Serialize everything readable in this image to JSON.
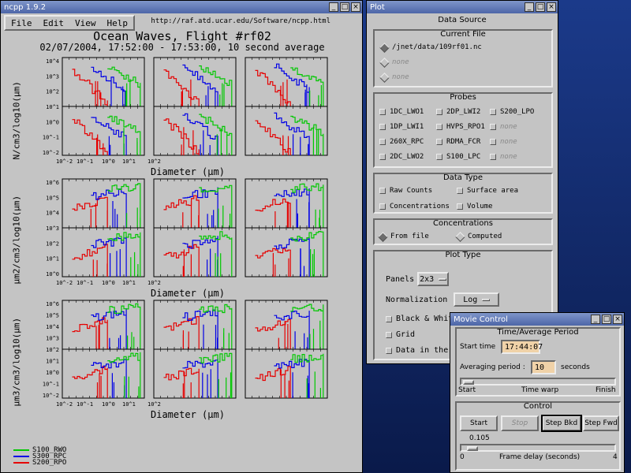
{
  "ncpp": {
    "title": "ncpp 1.9.2",
    "menu": [
      "File",
      "Edit",
      "View",
      "Help"
    ],
    "url": "http://raf.atd.ucar.edu/Software/ncpp.html",
    "plot_title": "Ocean Waves, Flight #rf02",
    "plot_subtitle": "02/07/2004, 17:52:00 - 17:53:00, 10 second average",
    "sections": [
      {
        "ylabel": "N/cm3/log10(μm)",
        "ticks_y": [
          "10^4",
          "10^3",
          "10^2",
          "10^1",
          "10^0",
          "10^-1",
          "10^-2"
        ],
        "xlabel": "Diameter (μm)"
      },
      {
        "ylabel": "μm2/cm3/log10(μm)",
        "ticks_y": [
          "10^6",
          "10^5",
          "10^4",
          "10^3",
          "10^2",
          "10^1",
          "10^0"
        ],
        "xlabel": "Diameter (μm)"
      },
      {
        "ylabel": "μm3/cm3/log10(μm)",
        "ticks_y": [
          "10^6",
          "10^5",
          "10^4",
          "10^3",
          "10^2",
          "10^1",
          "10^0",
          "10^-1",
          "10^-2"
        ],
        "xlabel": "Diameter (μm)"
      }
    ],
    "ticks_x": [
      "10^-2",
      "10^-1",
      "10^0",
      "10^1",
      "10^2"
    ],
    "legend": [
      {
        "name": "S100_RWO",
        "color": "#00c800"
      },
      {
        "name": "S300_RPC",
        "color": "#0000e6"
      },
      {
        "name": "S200_RPO",
        "color": "#e60000"
      }
    ]
  },
  "plot": {
    "title": "Plot",
    "data_source": "Data Source",
    "current_file": "Current File",
    "files": [
      {
        "label": "/jnet/data/109rf01.nc",
        "selected": true,
        "disabled": false
      },
      {
        "label": "none",
        "selected": false,
        "disabled": true
      },
      {
        "label": "none",
        "selected": false,
        "disabled": true
      }
    ],
    "probes_title": "Probes",
    "probes": [
      {
        "label": "1DC_LWO1",
        "disabled": false
      },
      {
        "label": "2DP_LWI2",
        "disabled": false
      },
      {
        "label": "S200_LPO",
        "disabled": false
      },
      {
        "label": "1DP_LWI1",
        "disabled": false
      },
      {
        "label": "HVPS_RPO1",
        "disabled": false
      },
      {
        "label": "none",
        "disabled": true
      },
      {
        "label": "260X_RPC",
        "disabled": false
      },
      {
        "label": "RDMA_FCR",
        "disabled": false
      },
      {
        "label": "none",
        "disabled": true
      },
      {
        "label": "2DC_LWO2",
        "disabled": false
      },
      {
        "label": "S100_LPC",
        "disabled": false
      },
      {
        "label": "none",
        "disabled": true
      }
    ],
    "data_type_title": "Data Type",
    "data_types": [
      "Raw Counts",
      "Surface area",
      "Concentrations",
      "Volume"
    ],
    "conc_title": "Concentrations",
    "conc_opts": [
      {
        "label": "From file",
        "selected": true
      },
      {
        "label": "Computed",
        "selected": false
      }
    ],
    "plot_type_title": "Plot Type",
    "panels_label": "Panels",
    "panels_value": "2x3",
    "norm_label": "Normalization",
    "norm_value": "Log",
    "bw_label": "Black & White",
    "grid_label": "Grid",
    "data_in_label": "Data in the"
  },
  "movie": {
    "title": "Movie Control",
    "period_title": "Time/Average Period",
    "start_label": "Start time",
    "start_value": "17:44:07",
    "avg_label": "Averaging period :",
    "avg_value": "10",
    "avg_unit": "seconds",
    "warp_left": "Start",
    "warp_mid": "Time warp",
    "warp_right": "Finish",
    "control_title": "Control",
    "buttons": [
      {
        "label": "Start",
        "disabled": false,
        "selected": false
      },
      {
        "label": "Stop",
        "disabled": true,
        "selected": false
      },
      {
        "label": "Step Bkd",
        "disabled": false,
        "selected": true
      },
      {
        "label": "Step Fwd",
        "disabled": false,
        "selected": false
      }
    ],
    "delay_value": "0.105",
    "delay_min": "0",
    "delay_label": "Frame delay (seconds)",
    "delay_max": "4",
    "delay_fraction": 0.026
  }
}
